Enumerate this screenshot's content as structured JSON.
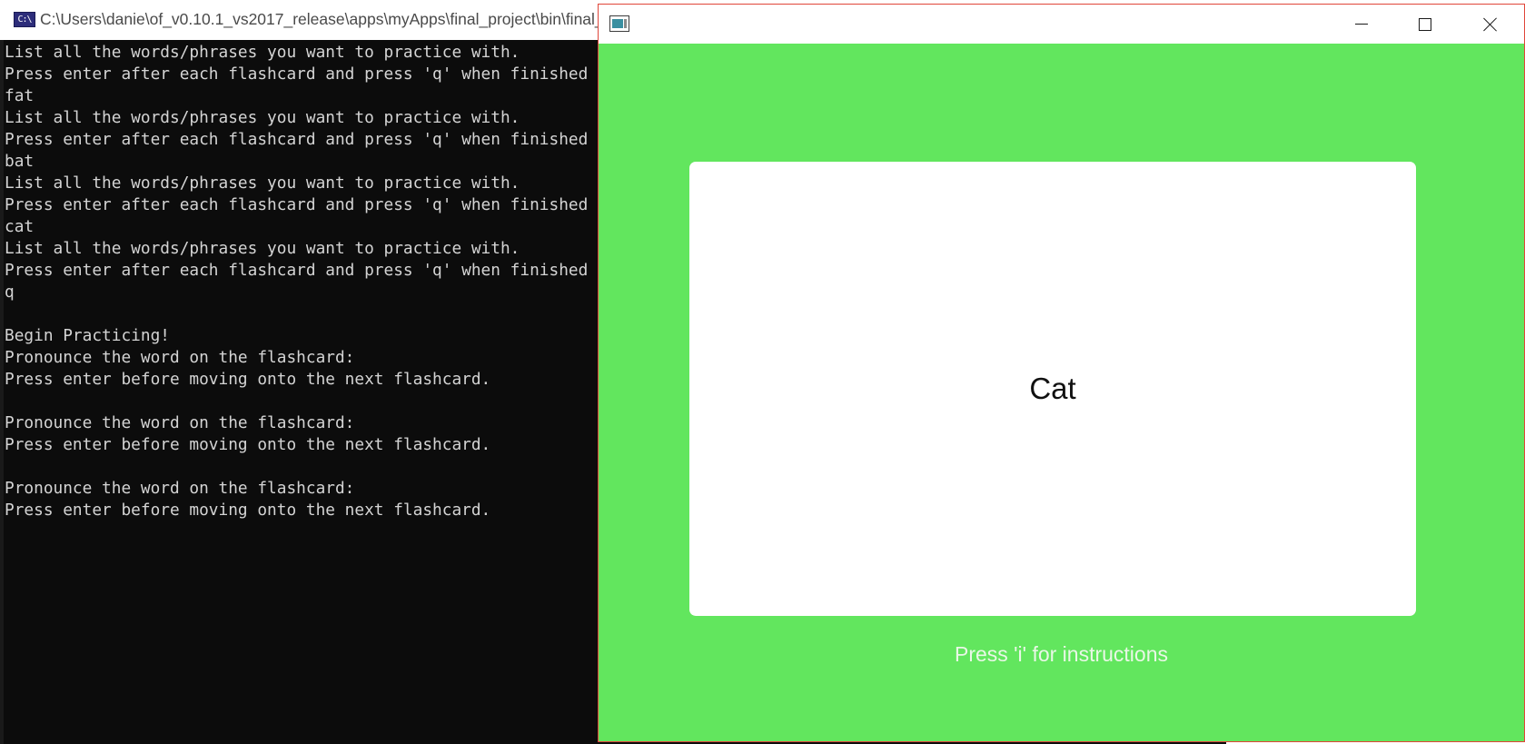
{
  "console": {
    "title": "C:\\Users\\danie\\of_v0.10.1_vs2017_release\\apps\\myApps\\final_project\\bin\\final_project_debug.exe",
    "icon": "cmd-icon",
    "lines": [
      "List all the words/phrases you want to practice with.",
      "Press enter after each flashcard and press 'q' when finished",
      "fat",
      "List all the words/phrases you want to practice with.",
      "Press enter after each flashcard and press 'q' when finished",
      "bat",
      "List all the words/phrases you want to practice with.",
      "Press enter after each flashcard and press 'q' when finished",
      "cat",
      "List all the words/phrases you want to practice with.",
      "Press enter after each flashcard and press 'q' when finished",
      "q",
      "",
      "Begin Practicing!",
      "Pronounce the word on the flashcard:",
      "Press enter before moving onto the next flashcard.",
      "",
      "Pronounce the word on the flashcard:",
      "Press enter before moving onto the next flashcard.",
      "",
      "Pronounce the word on the flashcard:",
      "Press enter before moving onto the next flashcard."
    ],
    "colors": {
      "background": "#0c0c0c",
      "text": "#d4d4d4"
    }
  },
  "app": {
    "icon": "app-window-icon",
    "controls": {
      "minimize": "minimize-icon",
      "maximize": "maximize-icon",
      "close": "close-icon"
    },
    "flashcard": {
      "word": "Cat"
    },
    "hint": "Press 'i' for instructions",
    "colors": {
      "background": "#62e65e",
      "card": "#ffffff",
      "hint_text": "#e9f7e6",
      "border": "#e0463a"
    }
  }
}
